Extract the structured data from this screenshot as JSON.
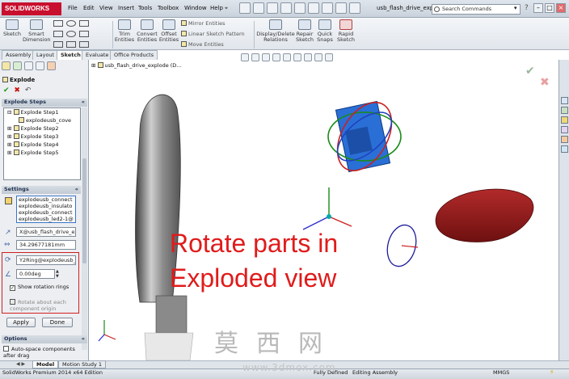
{
  "app": {
    "logo_text": "SOLIDWORKS",
    "menu": [
      "File",
      "Edit",
      "View",
      "Insert",
      "Tools",
      "Toolbox",
      "Window",
      "Help"
    ],
    "document_title": "usb_flash_drive_expl...",
    "search_placeholder": "Search Commands"
  },
  "ribbon": {
    "sketch": "Sketch",
    "smart_dimension": "Smart Dimension",
    "trim_entities": "Trim Entities",
    "convert_entities": "Convert Entities",
    "offset_entities": "Offset Entities",
    "mirror_entities": "Mirror Entities",
    "linear_sketch_pattern": "Linear Sketch Pattern",
    "move_entities": "Move Entities",
    "display_delete_relations": "Display/Delete Relations",
    "repair_sketch": "Repair Sketch",
    "quick_snaps": "Quick Snaps",
    "rapid_sketch": "Rapid Sketch"
  },
  "tabs": [
    "Assembly",
    "Layout",
    "Sketch",
    "Evaluate",
    "Office Products"
  ],
  "active_tab": "Sketch",
  "panel": {
    "title": "Explode",
    "explode_steps_header": "Explode Steps",
    "steps": [
      {
        "label": "Explode Step1",
        "expanded": true
      },
      {
        "label": "explodeusb_cove",
        "child": true
      },
      {
        "label": "Explode Step2"
      },
      {
        "label": "Explode Step3"
      },
      {
        "label": "Explode Step4"
      },
      {
        "label": "Explode Step5"
      }
    ],
    "settings_header": "Settings",
    "components": [
      "explodeusb_connect",
      "explodeusb_insulato",
      "explodeusb_connect",
      "explodeusb_led2-1@"
    ],
    "direction_field": "X@usb_flash_drive_expl",
    "distance_field": "34.29677181mm",
    "rotation_axis_field": "Y2Ring@explodeusb_co",
    "angle_field": "0.00deg",
    "show_rotation_rings": "Show rotation rings",
    "rotate_about_origin": "Rotate about each component origin",
    "apply": "Apply",
    "done": "Done",
    "options_header": "Options",
    "auto_space": "Auto-space components after drag"
  },
  "viewport": {
    "tree_label": "usb_flash_drive_explode (D...",
    "caption_line1": "Rotate parts in",
    "caption_line2": "Exploded view"
  },
  "bottom_tabs": [
    "Model",
    "Motion Study 1"
  ],
  "status": {
    "edition": "SolidWorks Premium 2014 x64 Edition",
    "fully_defined": "Fully Defined",
    "editing": "Editing Assembly",
    "mmgs": "MMGS"
  },
  "watermark": {
    "chars": "莫西网",
    "url": "www.3dmox.com"
  },
  "colors": {
    "caption_red": "#e01b1b",
    "cap_red": "#a01820",
    "connector_blue": "#2a6fd6"
  }
}
